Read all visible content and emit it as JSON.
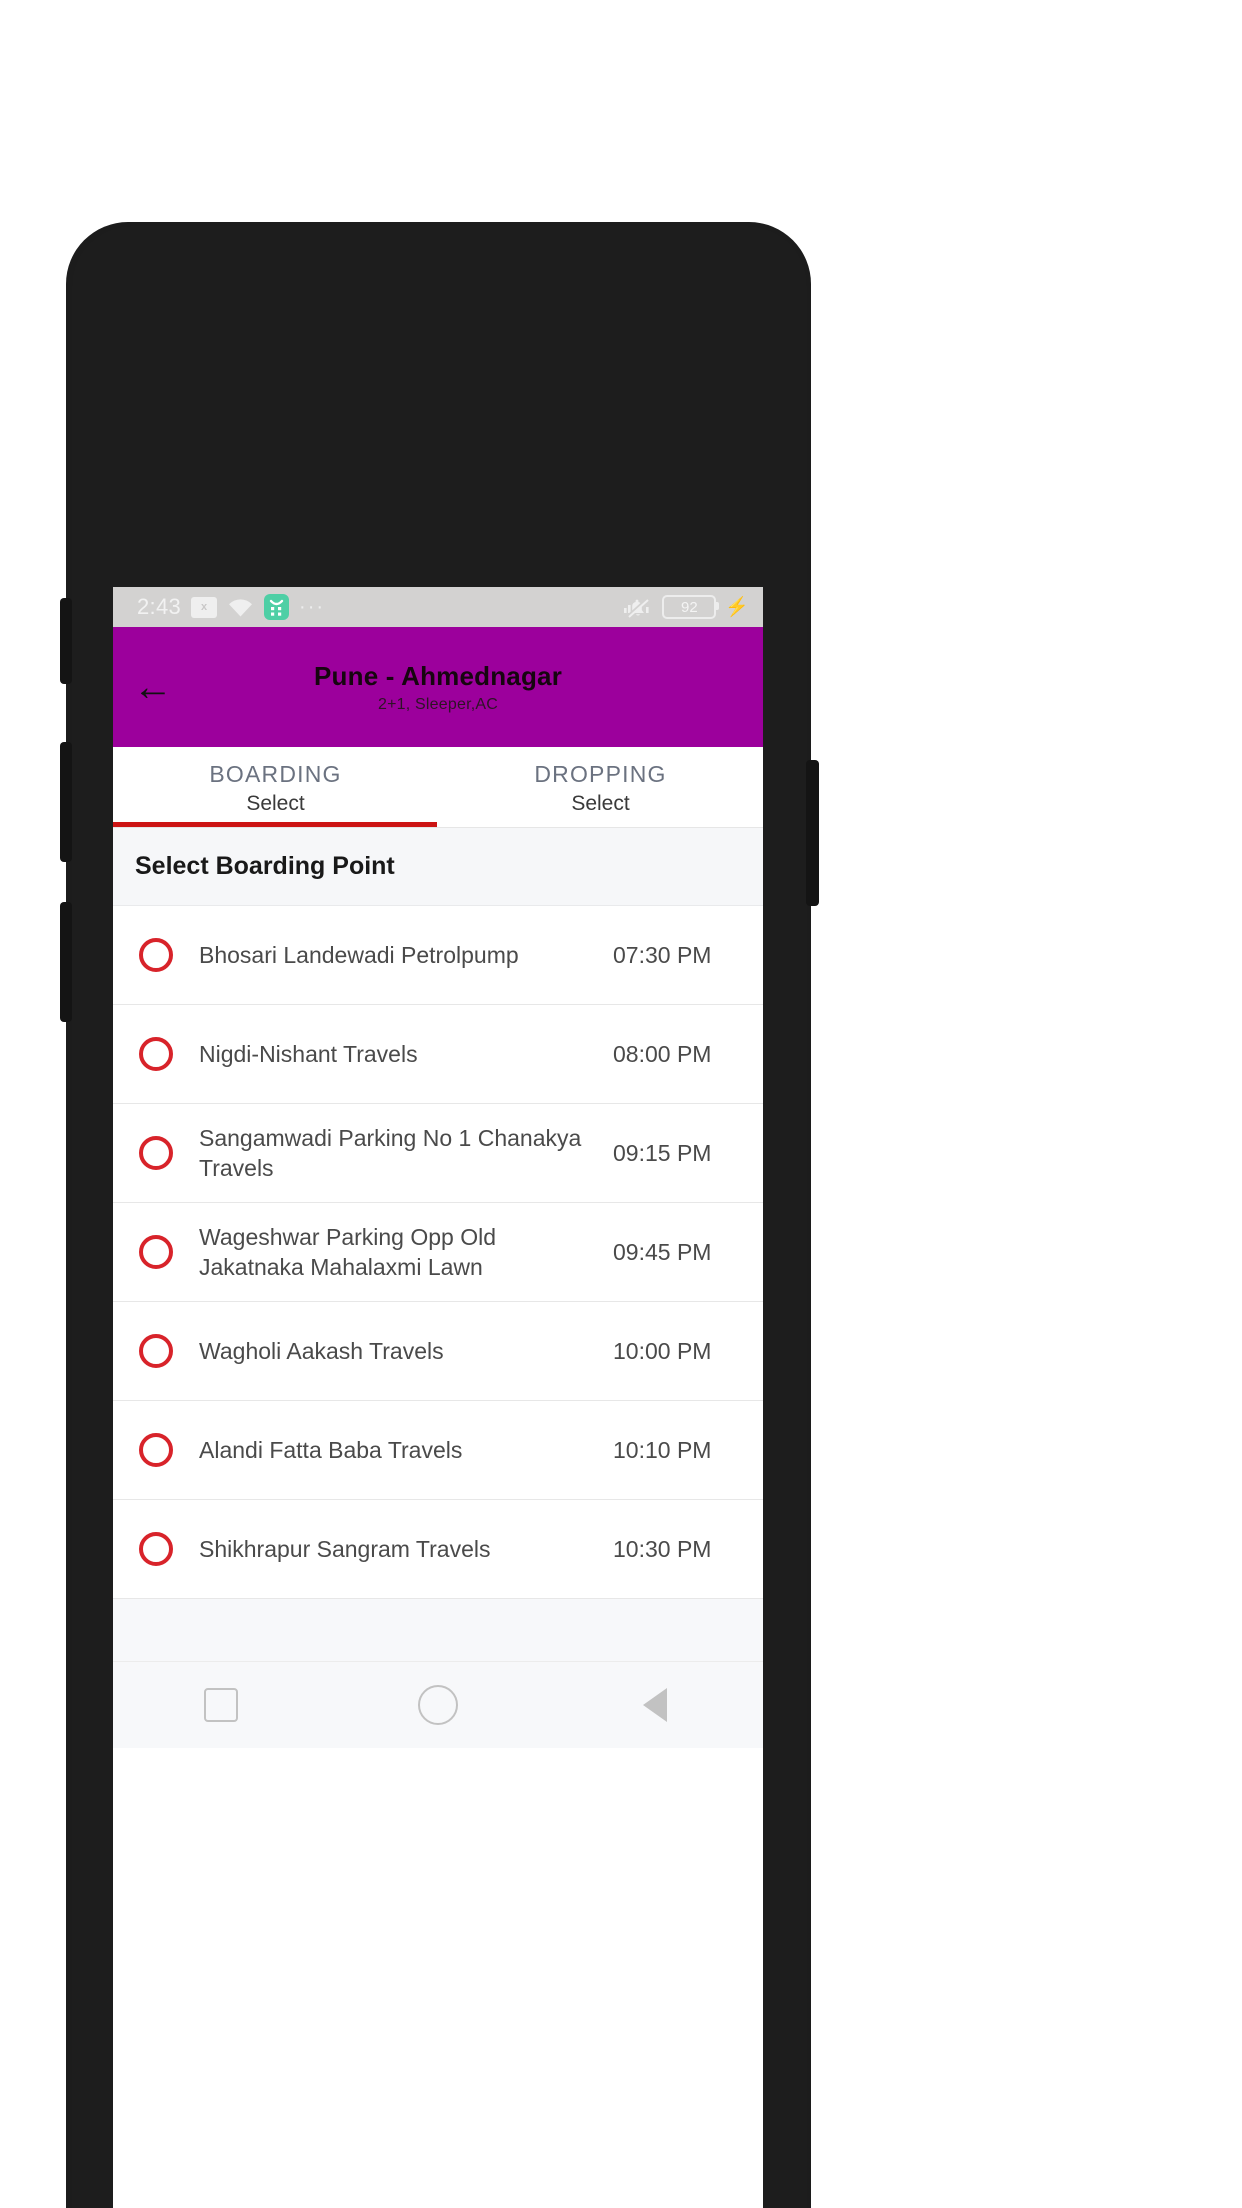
{
  "status_bar": {
    "time": "2:43",
    "sim_icon_label": "x",
    "wifi_icon": "wifi-icon",
    "app_icon": "calendar-app-icon",
    "overflow_dots": "···",
    "mute_icon": "bell-muted-icon",
    "battery_level": "92",
    "charging_icon": "⚡"
  },
  "app_bar": {
    "back_icon": "←",
    "title": "Pune - Ahmednagar",
    "subtitle": "2+1, Sleeper,AC",
    "background_color": "#9c009c"
  },
  "tabs": {
    "indicator_color": "#cc1414",
    "items": [
      {
        "title": "BOARDING",
        "sub": "Select",
        "active": true
      },
      {
        "title": "DROPPING",
        "sub": "Select",
        "active": false
      }
    ]
  },
  "section": {
    "header": "Select Boarding Point"
  },
  "boarding_points": [
    {
      "name": "Bhosari Landewadi Petrolpump",
      "time": "07:30 PM",
      "selected": false
    },
    {
      "name": "Nigdi-Nishant Travels",
      "time": "08:00 PM",
      "selected": false
    },
    {
      "name": "Sangamwadi Parking No 1 Chanakya Travels",
      "time": "09:15 PM",
      "selected": false
    },
    {
      "name": "Wageshwar Parking Opp Old Jakatnaka Mahalaxmi Lawn",
      "time": "09:45 PM",
      "selected": false
    },
    {
      "name": "Wagholi  Aakash Travels",
      "time": "10:00 PM",
      "selected": false
    },
    {
      "name": "Alandi Fatta  Baba Travels",
      "time": "10:10 PM",
      "selected": false
    },
    {
      "name": "Shikhrapur Sangram Travels",
      "time": "10:30 PM",
      "selected": false
    }
  ],
  "nav_bar": {
    "recents": "square-icon",
    "home": "circle-icon",
    "back": "triangle-back-icon"
  },
  "colors": {
    "accent_purple": "#9c009c",
    "radio_red": "#d8232a",
    "tab_red": "#cc1414"
  }
}
